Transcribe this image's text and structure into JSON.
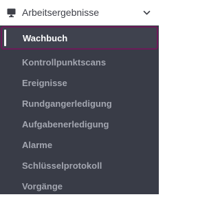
{
  "menu": {
    "header": {
      "label": "Arbeitsergebnisse",
      "icon": "monitor-icon",
      "expanded": true,
      "chevron_icon": "chevron-down-icon"
    },
    "items": [
      {
        "label": "Wachbuch",
        "active": true
      },
      {
        "label": "Kontrollpunktscans",
        "active": false
      },
      {
        "label": "Ereignisse",
        "active": false
      },
      {
        "label": "Rundgangerledigung",
        "active": false
      },
      {
        "label": "Aufgabenerledigung",
        "active": false
      },
      {
        "label": "Alarme",
        "active": false
      },
      {
        "label": "Schlüsselprotokoll",
        "active": false
      },
      {
        "label": "Vorgänge",
        "active": false
      }
    ]
  },
  "colors": {
    "submenu_background": "#393c47",
    "active_border": "#6e1a5a",
    "inactive_text": "#a3a6b0",
    "active_text": "#ffffff",
    "header_text": "#3f4149"
  }
}
